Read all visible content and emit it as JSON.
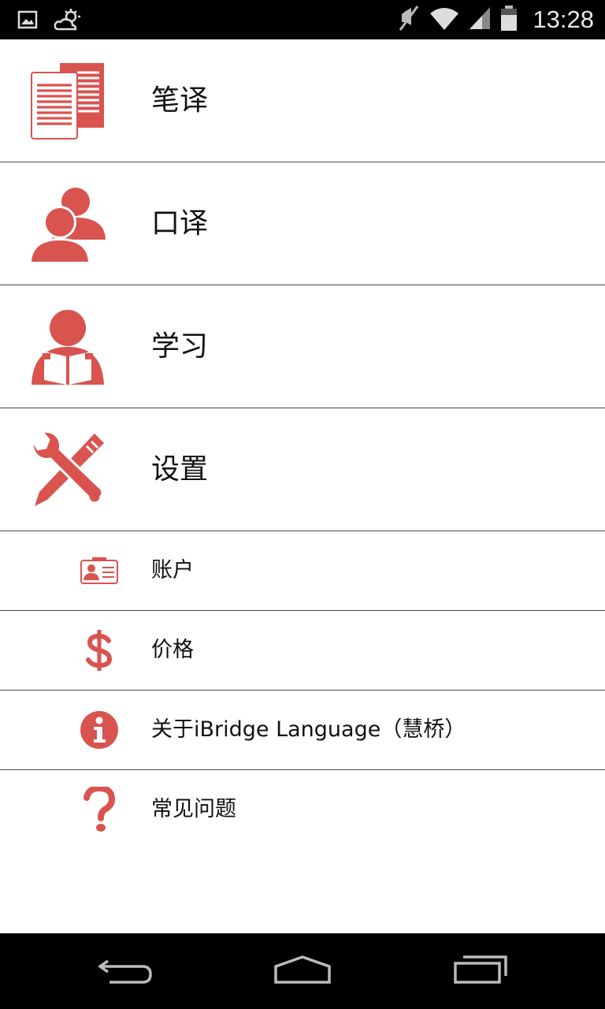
{
  "status_bar": {
    "time": "13:28",
    "icons": [
      "image-icon",
      "weather-icon",
      "mute-icon",
      "wifi-icon",
      "signal-icon",
      "battery-icon"
    ]
  },
  "menu": {
    "accent_color": "#d9534f",
    "items": [
      {
        "label": "笔译",
        "icon": "document-icon",
        "size": "large"
      },
      {
        "label": "口译",
        "icon": "people-icon",
        "size": "large"
      },
      {
        "label": "学习",
        "icon": "reader-icon",
        "size": "large"
      },
      {
        "label": "设置",
        "icon": "tools-icon",
        "size": "large"
      },
      {
        "label": "账户",
        "icon": "id-card-icon",
        "size": "small"
      },
      {
        "label": "价格",
        "icon": "dollar-icon",
        "size": "small"
      },
      {
        "label": "关于iBridge Language（慧桥）",
        "icon": "info-icon",
        "size": "small"
      },
      {
        "label": "常见问题",
        "icon": "question-icon",
        "size": "small"
      }
    ]
  },
  "nav_bar": {
    "buttons": [
      "back-icon",
      "home-icon",
      "recents-icon"
    ]
  }
}
